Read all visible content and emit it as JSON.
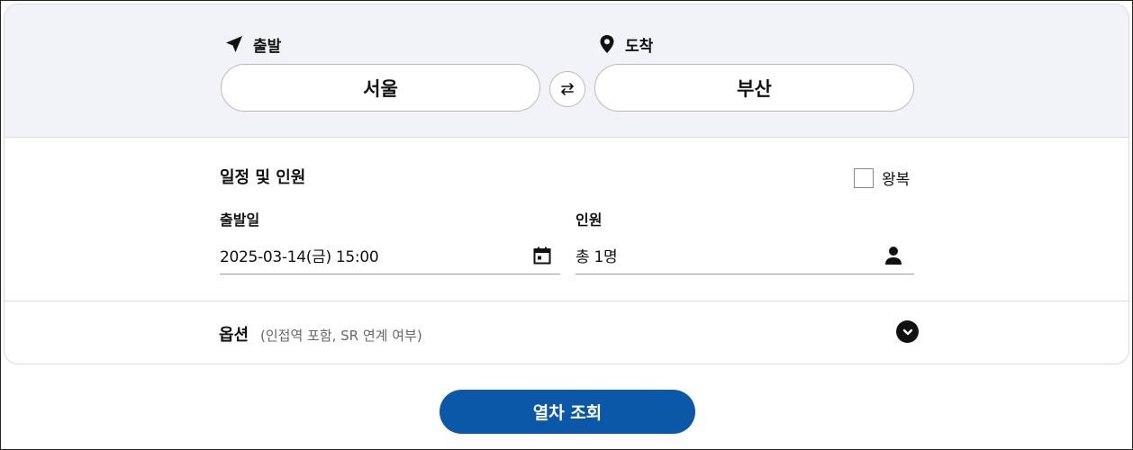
{
  "route": {
    "departure_label": "출발",
    "departure_value": "서울",
    "arrival_label": "도착",
    "arrival_value": "부산",
    "swap_icon": "swap-arrows-icon"
  },
  "schedule": {
    "title": "일정 및 인원",
    "roundtrip_label": "왕복",
    "roundtrip_checked": false,
    "date_label": "출발일",
    "date_value": "2025-03-14(금) 15:00",
    "passengers_label": "인원",
    "passengers_value": "총 1명"
  },
  "options": {
    "title": "옵션",
    "subtitle": "(인접역 포함, SR 연계 여부)"
  },
  "search": {
    "label": "열차 조회"
  },
  "colors": {
    "primary": "#0b57a8",
    "route_bg": "#f2f3f8",
    "border": "#d9dbe0"
  }
}
